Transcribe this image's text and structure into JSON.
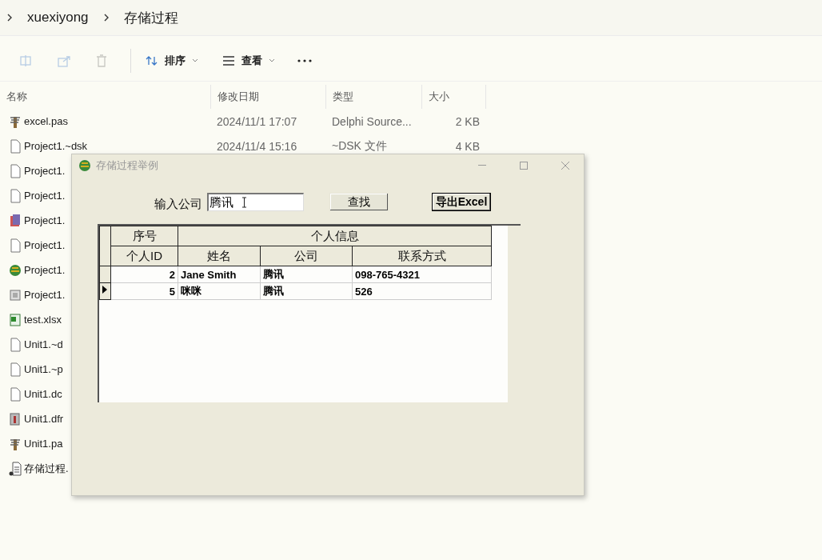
{
  "explorer": {
    "breadcrumb": [
      "xuexiyong",
      "存储过程"
    ],
    "icon_buttons": [
      {
        "kind": "rename",
        "disabled": true
      },
      {
        "kind": "share",
        "disabled": true
      },
      {
        "kind": "delete",
        "disabled": true
      }
    ],
    "sort_label": "排序",
    "view_label": "查看",
    "columns": [
      "名称",
      "修改日期",
      "类型",
      "大小"
    ],
    "files": [
      {
        "name": "excel.pas",
        "date": "2024/11/1 17:07",
        "type": "Delphi Source...",
        "size": "2 KB",
        "kind": "source"
      },
      {
        "name": "Project1.~dsk",
        "date": "2024/11/4 15:16",
        "type": "~DSK 文件",
        "size": "4 KB",
        "kind": "document"
      },
      {
        "name": "Project1.",
        "kind": "document"
      },
      {
        "name": "Project1.",
        "kind": "document"
      },
      {
        "name": "Project1.",
        "kind": "project"
      },
      {
        "name": "Project1.",
        "kind": "document"
      },
      {
        "name": "Project1.",
        "kind": "program"
      },
      {
        "name": "Project1.",
        "kind": "resource"
      },
      {
        "name": "test.xlsx",
        "kind": "spreadsheet"
      },
      {
        "name": "Unit1.~d",
        "kind": "document"
      },
      {
        "name": "Unit1.~p",
        "kind": "document"
      },
      {
        "name": "Unit1.dc",
        "kind": "document"
      },
      {
        "name": "Unit1.dfr",
        "kind": "form"
      },
      {
        "name": "Unit1.pa",
        "kind": "source"
      },
      {
        "name": "存储过程.",
        "kind": "script"
      }
    ]
  },
  "dialog": {
    "title": "存储过程举例",
    "active": false,
    "search_label": "输入公司",
    "search_value": "腾讯",
    "buttons": [
      {
        "label": "查找",
        "focused": false
      },
      {
        "label": "导出Excel",
        "focused": true
      }
    ],
    "grid": {
      "groups": [
        {
          "label": "序号",
          "columns": [
            {
              "label": "个人ID"
            }
          ]
        },
        {
          "label": "个人信息",
          "columns": [
            {
              "label": "姓名"
            },
            {
              "label": "公司"
            },
            {
              "label": "联系方式"
            }
          ]
        }
      ],
      "rows": [
        {
          "cells": [
            "2",
            "Jane Smith",
            "腾讯",
            "098-765-4321"
          ],
          "selected": false
        },
        {
          "cells": [
            "5",
            "咪咪",
            "腾讯",
            "526"
          ],
          "selected": true
        }
      ]
    }
  }
}
